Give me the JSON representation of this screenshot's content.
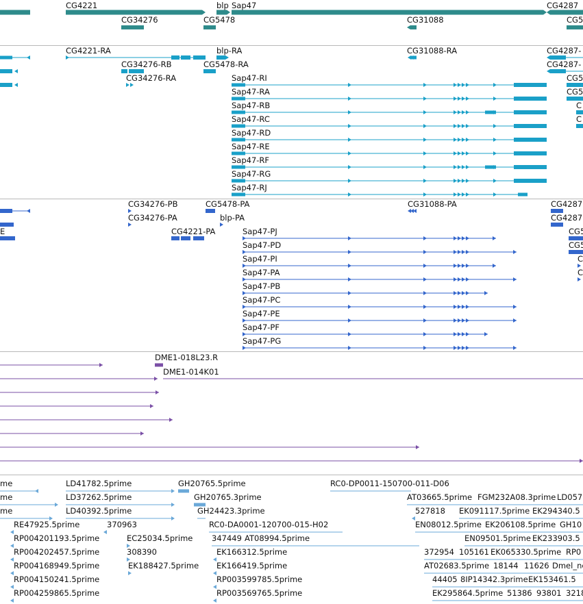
{
  "colors": {
    "gene_track": "#2e8b8b",
    "transcript_track_1": "#1aa0c8",
    "transcript_track_2": "#3366cc",
    "clone_track": "#7a4fa6",
    "est_track": "#6aa8d8",
    "separator": "#b8b8b8"
  },
  "tracks": {
    "genes": {
      "labels": [
        "CG4221",
        "blp",
        "Sap47",
        "CG4287",
        "CG34276",
        "CG5478",
        "CG31088",
        "CG5"
      ]
    },
    "transcripts_a": {
      "labels": [
        "CG4221-RA",
        "blp-RA",
        "CG31088-RA",
        "CG4287-",
        "CG34276-RB",
        "CG5478-RA",
        "CG4287-",
        "CG34276-RA",
        "Sap47-RI",
        "Sap47-RA",
        "Sap47-RB",
        "Sap47-RC",
        "Sap47-RD",
        "Sap47-RE",
        "Sap47-RF",
        "Sap47-RG",
        "Sap47-RJ",
        "CG5",
        "CG5",
        "C",
        "C"
      ]
    },
    "transcripts_b": {
      "labels": [
        "CG34276-PB",
        "CG5478-PA",
        "CG31088-PA",
        "CG4287",
        "CG34276-PA",
        "blp-PA",
        "CG4287",
        "CG4221-PA",
        "Sap47-PJ",
        "Sap47-PD",
        "Sap47-PI",
        "Sap47-PA",
        "Sap47-PB",
        "Sap47-PC",
        "Sap47-PE",
        "Sap47-PF",
        "Sap47-PG",
        "E",
        "CG5",
        "CG5",
        "C",
        "C"
      ]
    },
    "clones": {
      "labels": [
        "DME1-018L23.R",
        "DME1-014K01"
      ]
    },
    "ests": {
      "labels": [
        "me",
        "LD41782.5prime",
        "GH20765.5prime",
        "RC0-DP0011-150700-011-D06",
        "me",
        "LD37262.5prime",
        "GH20765.3prime",
        "AT03665.5prime",
        "FGM232A08.3prime",
        "LD057",
        "me",
        "LD40392.5prime",
        "GH24423.3prime",
        "527818",
        "EK091117.5prime",
        "EK294340.5",
        "RE47925.5prime",
        "370963",
        "RC0-DA0001-120700-015-H02",
        "EN08012.5prime",
        "EK206108.5prime",
        "GH10",
        "RP004201193.5prime",
        "EC25034.5prime",
        "347449",
        "AT08994.5prime",
        "EN09501.5prime",
        "EK233903.5",
        "RP004202457.5prime",
        "308390",
        "EK166312.5prime",
        "372954",
        "105161",
        "EK065330.5prime",
        "RP0",
        "RP004168949.5prime",
        "EK188427.5prime",
        "EK166419.5prime",
        "AT02683.5prime",
        "18144",
        "11626",
        "Dmel_ne",
        "RP004150241.5prime",
        "RP003599785.5prime",
        "44405",
        "8IP14342.3prime",
        "EK153461.5",
        "RP004259865.5prime",
        "RP003569765.5prime",
        "EK295864.5prime",
        "51386",
        "93801",
        "3218"
      ]
    }
  }
}
